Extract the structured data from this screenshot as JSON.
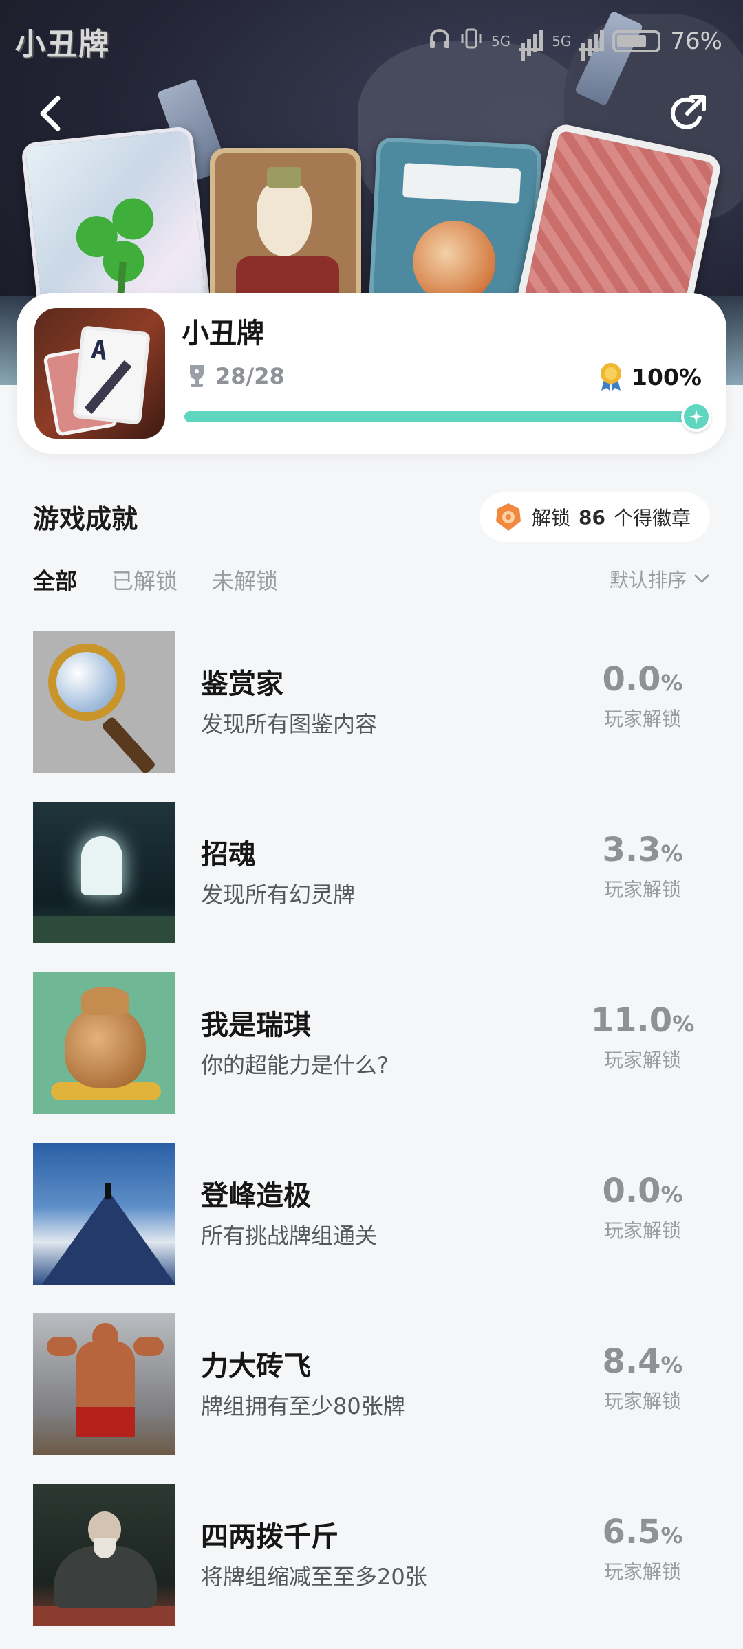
{
  "status_bar": {
    "app_logo_text": "小丑牌",
    "battery_percent": "76%",
    "network_labels": [
      "5G",
      "5G"
    ]
  },
  "nav": {
    "back_icon": "chevron-left-icon",
    "share_icon": "share-icon"
  },
  "game": {
    "title": "小丑牌",
    "trophy_count": "28/28",
    "completion": "100%",
    "progress_value": 1.0,
    "accent_color": "#5ed6c0"
  },
  "achievements_section": {
    "title": "游戏成就",
    "badge_prefix": "解锁",
    "badge_count": "86",
    "badge_suffix": "个得徽章",
    "tabs": [
      {
        "label": "全部",
        "active": true
      },
      {
        "label": "已解锁",
        "active": false
      },
      {
        "label": "未解锁",
        "active": false
      }
    ],
    "sort_label": "默认排序"
  },
  "achievements": [
    {
      "name": "鉴赏家",
      "desc": "发现所有图鉴内容",
      "pct": "0.0",
      "unit": "%",
      "sub": "玩家解锁",
      "image": "magnifier"
    },
    {
      "name": "招魂",
      "desc": "发现所有幻灵牌",
      "pct": "3.3",
      "unit": "%",
      "sub": "玩家解锁",
      "image": "ghost"
    },
    {
      "name": "我是瑞琪",
      "desc": "你的超能力是什么?",
      "pct": "11.0",
      "unit": "%",
      "sub": "玩家解锁",
      "image": "bag"
    },
    {
      "name": "登峰造极",
      "desc": "所有挑战牌组通关",
      "pct": "0.0",
      "unit": "%",
      "sub": "玩家解锁",
      "image": "peak"
    },
    {
      "name": "力大砖飞",
      "desc": "牌组拥有至少80张牌",
      "pct": "8.4",
      "unit": "%",
      "sub": "玩家解锁",
      "image": "strong"
    },
    {
      "name": "四两拨千斤",
      "desc": "将牌组缩减至至多20张",
      "pct": "6.5",
      "unit": "%",
      "sub": "玩家解锁",
      "image": "monk"
    }
  ]
}
